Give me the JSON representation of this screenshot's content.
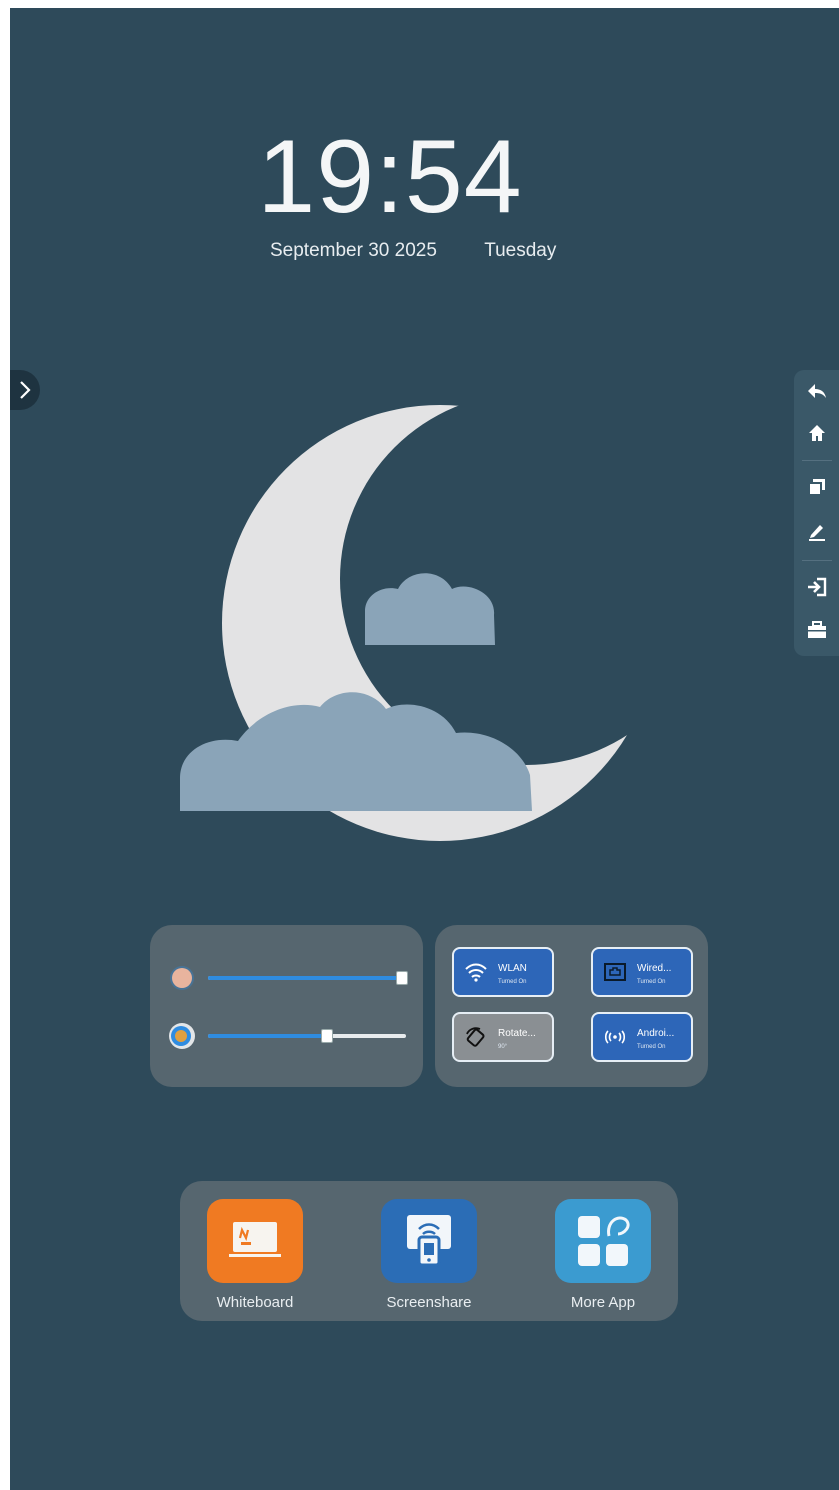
{
  "clock": {
    "time": "19:54",
    "date": "September 30 2025",
    "weekday": "Tuesday"
  },
  "colors": {
    "background": "#2e4a5a",
    "accent_blue": "#2d66b8",
    "slider_fill": "#2f8ce0",
    "whiteboard": "#f07a22",
    "screenshare": "#2b6db6",
    "more_app": "#3b9bd0"
  },
  "toolbar": {
    "items": [
      {
        "name": "back",
        "icon": "back-arrow-icon"
      },
      {
        "name": "home",
        "icon": "home-icon"
      },
      {
        "name": "windows",
        "icon": "windows-icon"
      },
      {
        "name": "annotate",
        "icon": "pen-icon"
      },
      {
        "name": "input-source",
        "icon": "input-icon"
      },
      {
        "name": "toolbox",
        "icon": "toolbox-icon"
      }
    ]
  },
  "sliders": {
    "brightness": {
      "icon": "brightness-icon",
      "level": 1.0
    },
    "volume": {
      "icon": "volume-icon",
      "level": 0.6
    }
  },
  "tiles": [
    {
      "title": "WLAN",
      "status": "Turned On",
      "icon": "wifi-icon",
      "state": "on"
    },
    {
      "title": "Wired...",
      "status": "Turned On",
      "icon": "ethernet-icon",
      "state": "on"
    },
    {
      "title": "Rotate...",
      "status": "90°",
      "icon": "rotate-icon",
      "state": "off"
    },
    {
      "title": "Androi...",
      "status": "Turned On",
      "icon": "hotspot-icon",
      "state": "on"
    }
  ],
  "dock": {
    "apps": [
      {
        "label": "Whiteboard",
        "icon": "whiteboard-icon"
      },
      {
        "label": "Screenshare",
        "icon": "screenshare-icon"
      },
      {
        "label": "More App",
        "icon": "more-apps-icon"
      }
    ]
  }
}
